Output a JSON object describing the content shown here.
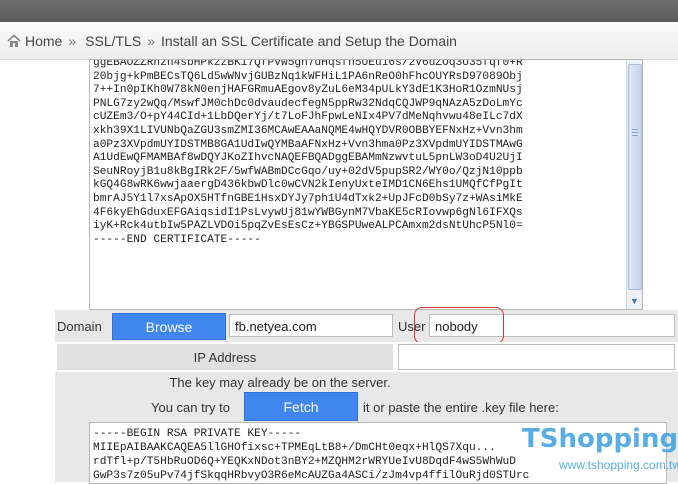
{
  "breadcrumb": {
    "home": "Home",
    "separator": "»",
    "section": "SSL/TLS",
    "current": "Install an SSL Certificate and Setup the Domain"
  },
  "certificate": {
    "lines": [
      "ggEBAOZZRhzn4sbHPkzzBKi7QfPvw5gh7dHqsfh5UEu16s/2V6uZOq3U35fqf0+R",
      "20bjg+kPmBECsTQ6Ld5wWNvjGUBzNq1kWFHiL1PA6nReO0hFhcOUYRsD97089Obj",
      "7++In0pIKh0W78kN0enjHAFGRmuAEgov8yZuL6eM34pULkY3dE1K3HoR1OzmNUsj",
      "PNLG7zy2wQq/MswfJM0chDc0dvaudecfegN5ppRw32NdqCQJWP9qNAzA5zDoLmYc",
      "cUZEm3/O+pY44CId+1LbDQerYj/t7LoFJhFpwLeNIx4PV7dMeNqhvwu48eILc7dX",
      "xkh39X1LIVUNbQaZGU3smZMI36MCAwEAAaNQME4wHQYDVR0OBBYEFNxHz+Vvn3hm",
      "a0Pz3XVpdmUYIDSTMB8GA1UdIwQYMBaAFNxHz+Vvn3hma0Pz3XVpdmUYIDSTMAwG",
      "A1UdEwQFMAMBAf8wDQYJKoZIhvcNAQEFBQADggEBAMmNzwvtuL5pnLW3oD4U2UjI",
      "SeuNRoyjB1u8kBgIRk2F/5wfWABmDCcGqo/uy+02dV5pupSR2/WY0o/QzjN10ppb",
      "kGQ4G8wRK6wwjaaergD436kbwDlc0wCVN2kIenyUxteIMD1CN6Ehs1UMQfCfPgIt",
      "bmrAJ5Y1l7xsApOX5HTfnGBE1HsxDYJy7ph1U4dTxk2+UpJFcD0bSy7z+WAsiMkE",
      "4F6kyEhGduxEFGAiqsidI1PsLvywUj81wYWBGynM7VbaKE5cRIovwp6gNl6IFXQs",
      "iyK+Rck4utbIw5PAZLVDOi5pqZvEsEsCz+YBGSPUweALPCAmxm2dsNtUhcP5Nl0=",
      "-----END CERTIFICATE-----"
    ]
  },
  "domain_row": {
    "label": "Domain",
    "browse_label": "Browse",
    "domain_value": "fb.netyea.com",
    "user_label": "User",
    "user_value": "nobody"
  },
  "ip_row": {
    "label": "IP Address",
    "value": ""
  },
  "key_section": {
    "note": "The key may already be on the server.",
    "try_text": "You can try to",
    "fetch_label": "Fetch",
    "paste_text": "it or paste the entire .key file here:",
    "lines": [
      "-----BEGIN RSA PRIVATE KEY-----",
      "MIIEpAIBAAKCAQEA5llGHOfixsc+TPMEqLtB8+/DmCHt0eqx+HlQS7Xqu...",
      "rdTfl+p/T5HbRuOD6Q+YEQKxNDot3nBY2+MZQHM2rWRYUeIvU8DqdF4wS5WhWuD",
      "GwP3s7z05uPv74jfSkqqHRbvyO3R6eMcAUZGa4ASCi/zJm4vp4ffilOuRjd0STUrc"
    ]
  },
  "watermark": {
    "brand": "TShopping",
    "url": "www.tshopping.com.tw"
  },
  "colors": {
    "button_blue": "#3f86ef",
    "highlight_red": "#d63636",
    "watermark_blue": "#3aa0e0"
  }
}
